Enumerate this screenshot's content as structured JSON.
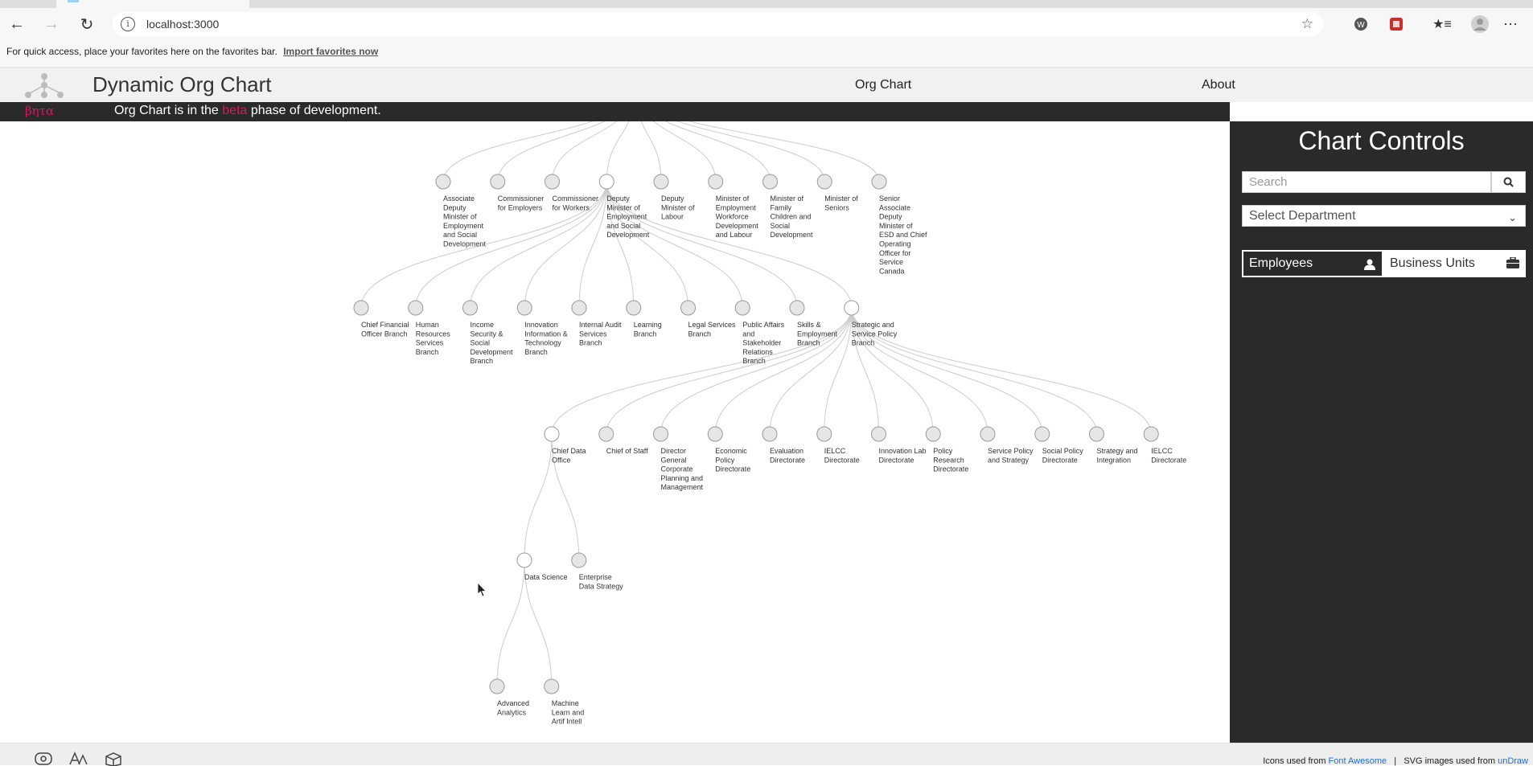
{
  "browser": {
    "url": "localhost:3000",
    "favbar_text": "For quick access, place your favorites here on the favorites bar.",
    "favbar_link": "Import favorites now"
  },
  "header": {
    "title": "Dynamic Org Chart",
    "nav_org_chart": "Org Chart",
    "nav_about": "About"
  },
  "beta": {
    "tag": "βητα",
    "msg_before": "Org Chart is in the ",
    "msg_highlight": "beta",
    "msg_after": " phase of development."
  },
  "controls": {
    "title": "Chart Controls",
    "search_placeholder": "Search",
    "department_placeholder": "Select Department",
    "toggle_employees": "Employees",
    "toggle_business_units": "Business Units"
  },
  "footer": {
    "icons_prefix": "Icons used from ",
    "icons_link": "Font Awesome",
    "separator": "|",
    "svg_prefix": "SVG images used from ",
    "svg_link": "unDraw"
  },
  "chart_data": {
    "type": "tree",
    "levels": [
      {
        "parent": "",
        "nodes": [
          [
            "Associate",
            "Deputy",
            "Minister of",
            "Employment",
            "and Social",
            "Development"
          ],
          [
            "Commissioner",
            "for Employers"
          ],
          [
            "Commissioner",
            "for Workers"
          ],
          [
            "Deputy",
            "Minister of",
            "Employment",
            "and Social",
            "Development"
          ],
          [
            "Deputy",
            "Minister of",
            "Labour"
          ],
          [
            "Minister of",
            "Employment",
            "Workforce",
            "Development",
            "and Labour"
          ],
          [
            "Minister of",
            "Family",
            "Children and",
            "Social",
            "Development"
          ],
          [
            "Minister of",
            "Seniors"
          ],
          [
            "Senior",
            "Associate",
            "Deputy",
            "Minister of",
            "ESD and Chief",
            "Operating",
            "Officer for",
            "Service",
            "Canada"
          ]
        ]
      },
      {
        "parent": "Deputy Minister of Employment and Social Development",
        "nodes": [
          [
            "Chief Financial",
            "Officer Branch"
          ],
          [
            "Human",
            "Resources",
            "Services",
            "Branch"
          ],
          [
            "Income",
            "Security &",
            "Social",
            "Development",
            "Branch"
          ],
          [
            "Innovation",
            "Information &",
            "Technology",
            "Branch"
          ],
          [
            "Internal Audit",
            "Services",
            "Branch"
          ],
          [
            "Learning",
            "Branch"
          ],
          [
            "Legal Services",
            "Branch"
          ],
          [
            "Public Affairs",
            "and",
            "Stakeholder",
            "Relations",
            "Branch"
          ],
          [
            "Skills &",
            "Employment",
            "Branch"
          ],
          [
            "Strategic and",
            "Service Policy",
            "Branch"
          ]
        ]
      },
      {
        "parent": "Strategic and Service Policy Branch",
        "nodes": [
          [
            "Chief Data",
            "Office"
          ],
          [
            "Chief of Staff"
          ],
          [
            "Director",
            "General",
            "Corporate",
            "Planning and",
            "Management"
          ],
          [
            "Economic",
            "Policy",
            "Directorate"
          ],
          [
            "Evaluation",
            "Directorate"
          ],
          [
            "IELCC",
            "Directorate"
          ],
          [
            "Innovation Lab",
            "Directorate"
          ],
          [
            "Policy",
            "Research",
            "Directorate"
          ],
          [
            "Service Policy",
            "and Strategy"
          ],
          [
            "Social Policy",
            "Directorate"
          ],
          [
            "Strategy and",
            "Integration"
          ],
          [
            "IELCC",
            "Directorate"
          ]
        ]
      },
      {
        "parent": "Chief Data Office",
        "nodes": [
          [
            "Data Science"
          ],
          [
            "Enterprise",
            "Data Strategy"
          ]
        ]
      },
      {
        "parent": "Data Science",
        "nodes": [
          [
            "Advanced",
            "Analytics"
          ],
          [
            "Machine",
            "Learn and",
            "Artif Intell"
          ]
        ]
      }
    ]
  }
}
